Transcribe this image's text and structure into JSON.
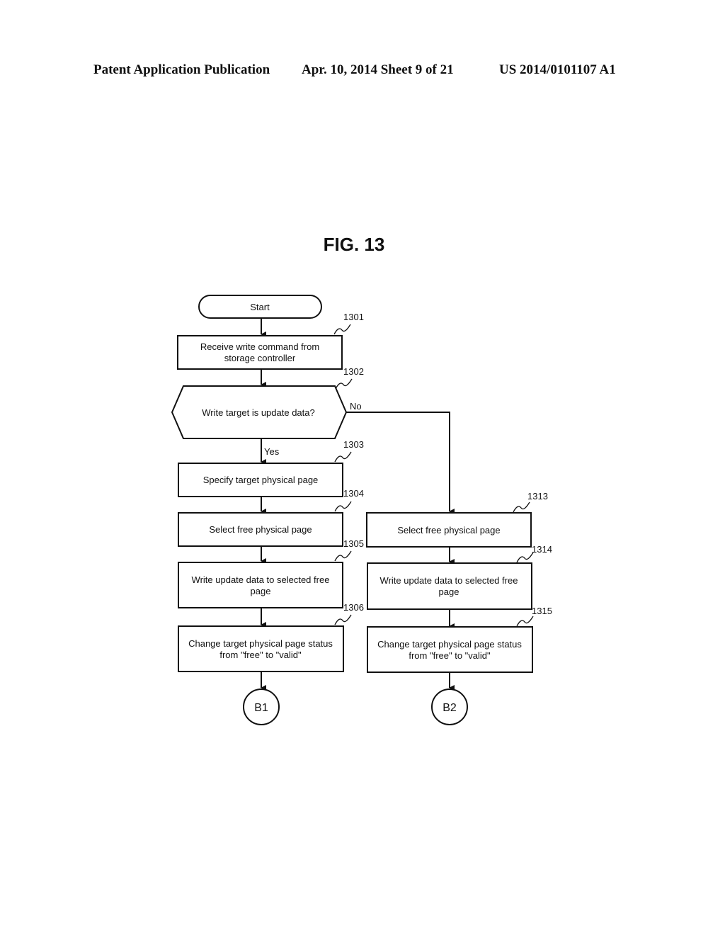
{
  "header": {
    "publication_type": "Patent Application Publication",
    "date_sheet": "Apr. 10, 2014  Sheet 9 of 21",
    "publication_number": "US 2014/0101107 A1"
  },
  "figure": {
    "title": "FIG. 13"
  },
  "flowchart": {
    "start": {
      "label": "Start"
    },
    "steps": {
      "s1301": {
        "ref": "1301",
        "lines": [
          "Receive write command from",
          "storage controller"
        ]
      },
      "s1302": {
        "ref": "1302",
        "lines": [
          "Write target is update data?"
        ],
        "yes_label": "Yes",
        "no_label": "No"
      },
      "s1303": {
        "ref": "1303",
        "lines": [
          "Specify target physical page"
        ]
      },
      "s1304": {
        "ref": "1304",
        "lines": [
          "Select free physical page"
        ]
      },
      "s1305": {
        "ref": "1305",
        "lines": [
          "Write update data to selected free",
          "page"
        ]
      },
      "s1306": {
        "ref": "1306",
        "lines": [
          "Change target physical page status",
          "from \"free\" to \"valid\""
        ]
      },
      "s1313": {
        "ref": "1313",
        "lines": [
          "Select free physical page"
        ]
      },
      "s1314": {
        "ref": "1314",
        "lines": [
          "Write update data to selected free",
          "page"
        ]
      },
      "s1315": {
        "ref": "1315",
        "lines": [
          "Change target physical page status",
          "from \"free\" to \"valid\""
        ]
      }
    },
    "connectors": {
      "b1": {
        "label": "B1"
      },
      "b2": {
        "label": "B2"
      }
    }
  }
}
